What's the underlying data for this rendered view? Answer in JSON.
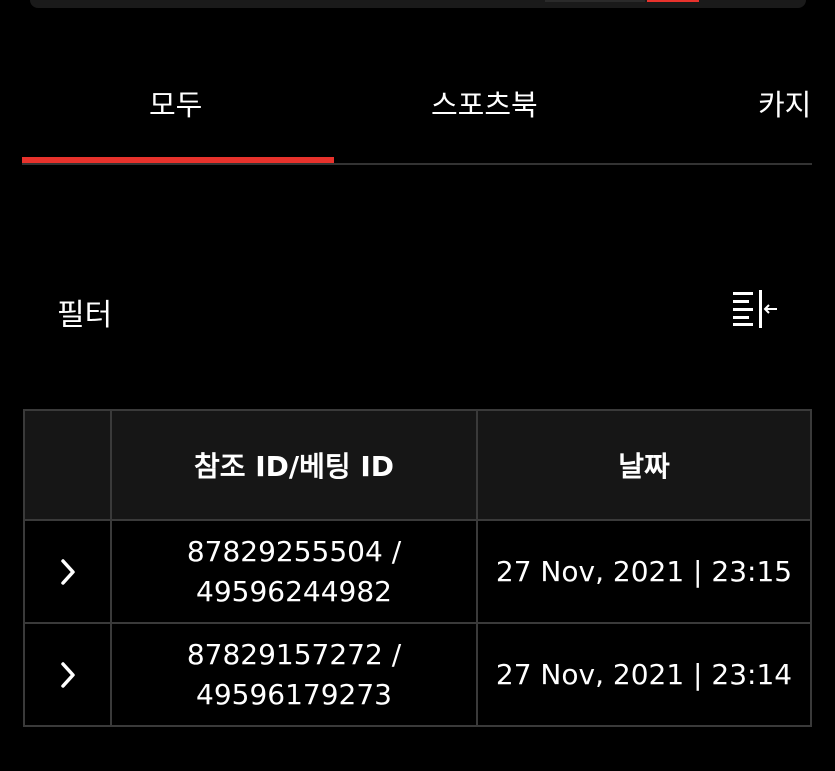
{
  "tabs": [
    {
      "label": "모두",
      "active": true
    },
    {
      "label": "스포츠북",
      "active": false
    },
    {
      "label": "카지",
      "active": false
    }
  ],
  "filter": {
    "label": "필터",
    "icon": "filter-collapse-icon"
  },
  "table": {
    "headers": {
      "expand": "",
      "ref": "참조 ID/베팅 ID",
      "date": "날짜"
    },
    "rows": [
      {
        "ref_id": "87829255504 /",
        "bet_id": "49596244982",
        "date": "27 Nov, 2021 | 23:15"
      },
      {
        "ref_id": "87829157272 /",
        "bet_id": "49596179273",
        "date": "27 Nov, 2021 | 23:14"
      }
    ]
  },
  "colors": {
    "accent": "#e8322c",
    "background": "#000000",
    "header_bg": "#161616",
    "border": "#3a3a3a"
  }
}
